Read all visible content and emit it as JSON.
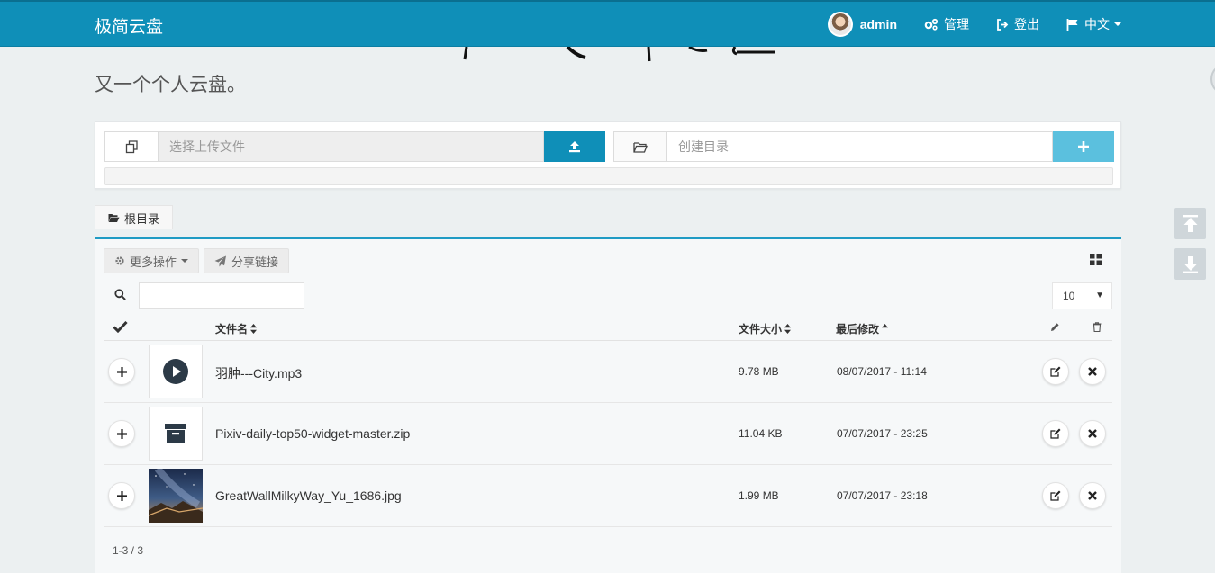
{
  "app": {
    "brand": "极简云盘",
    "tagline": "又一个个人云盘。"
  },
  "nav": {
    "user": "admin",
    "manage": "管理",
    "logout": "登出",
    "language": "中文"
  },
  "upload": {
    "file_placeholder": "选择上传文件",
    "dir_placeholder": "创建目录"
  },
  "breadcrumb": {
    "root": "根目录"
  },
  "toolbar": {
    "more_actions": "更多操作",
    "share_link": "分享链接",
    "page_size": "10"
  },
  "table": {
    "headers": {
      "name": "文件名",
      "size": "文件大小",
      "modified": "最后修改"
    },
    "rows": [
      {
        "name": "羽肿---City.mp3",
        "size": "9.78 MB",
        "modified": "08/07/2017 - 11:14",
        "type": "audio"
      },
      {
        "name": "Pixiv-daily-top50-widget-master.zip",
        "size": "11.04 KB",
        "modified": "07/07/2017 - 23:25",
        "type": "archive"
      },
      {
        "name": "GreatWallMilkyWay_Yu_1686.jpg",
        "size": "1.99 MB",
        "modified": "07/07/2017 - 23:18",
        "type": "image"
      }
    ],
    "pagination": "1-3 / 3"
  },
  "colors": {
    "navbar": "#0f8fb8",
    "primary_btn": "#0f8fb8",
    "secondary_btn": "#5bc0de",
    "accent_line": "#1f9bc4"
  }
}
